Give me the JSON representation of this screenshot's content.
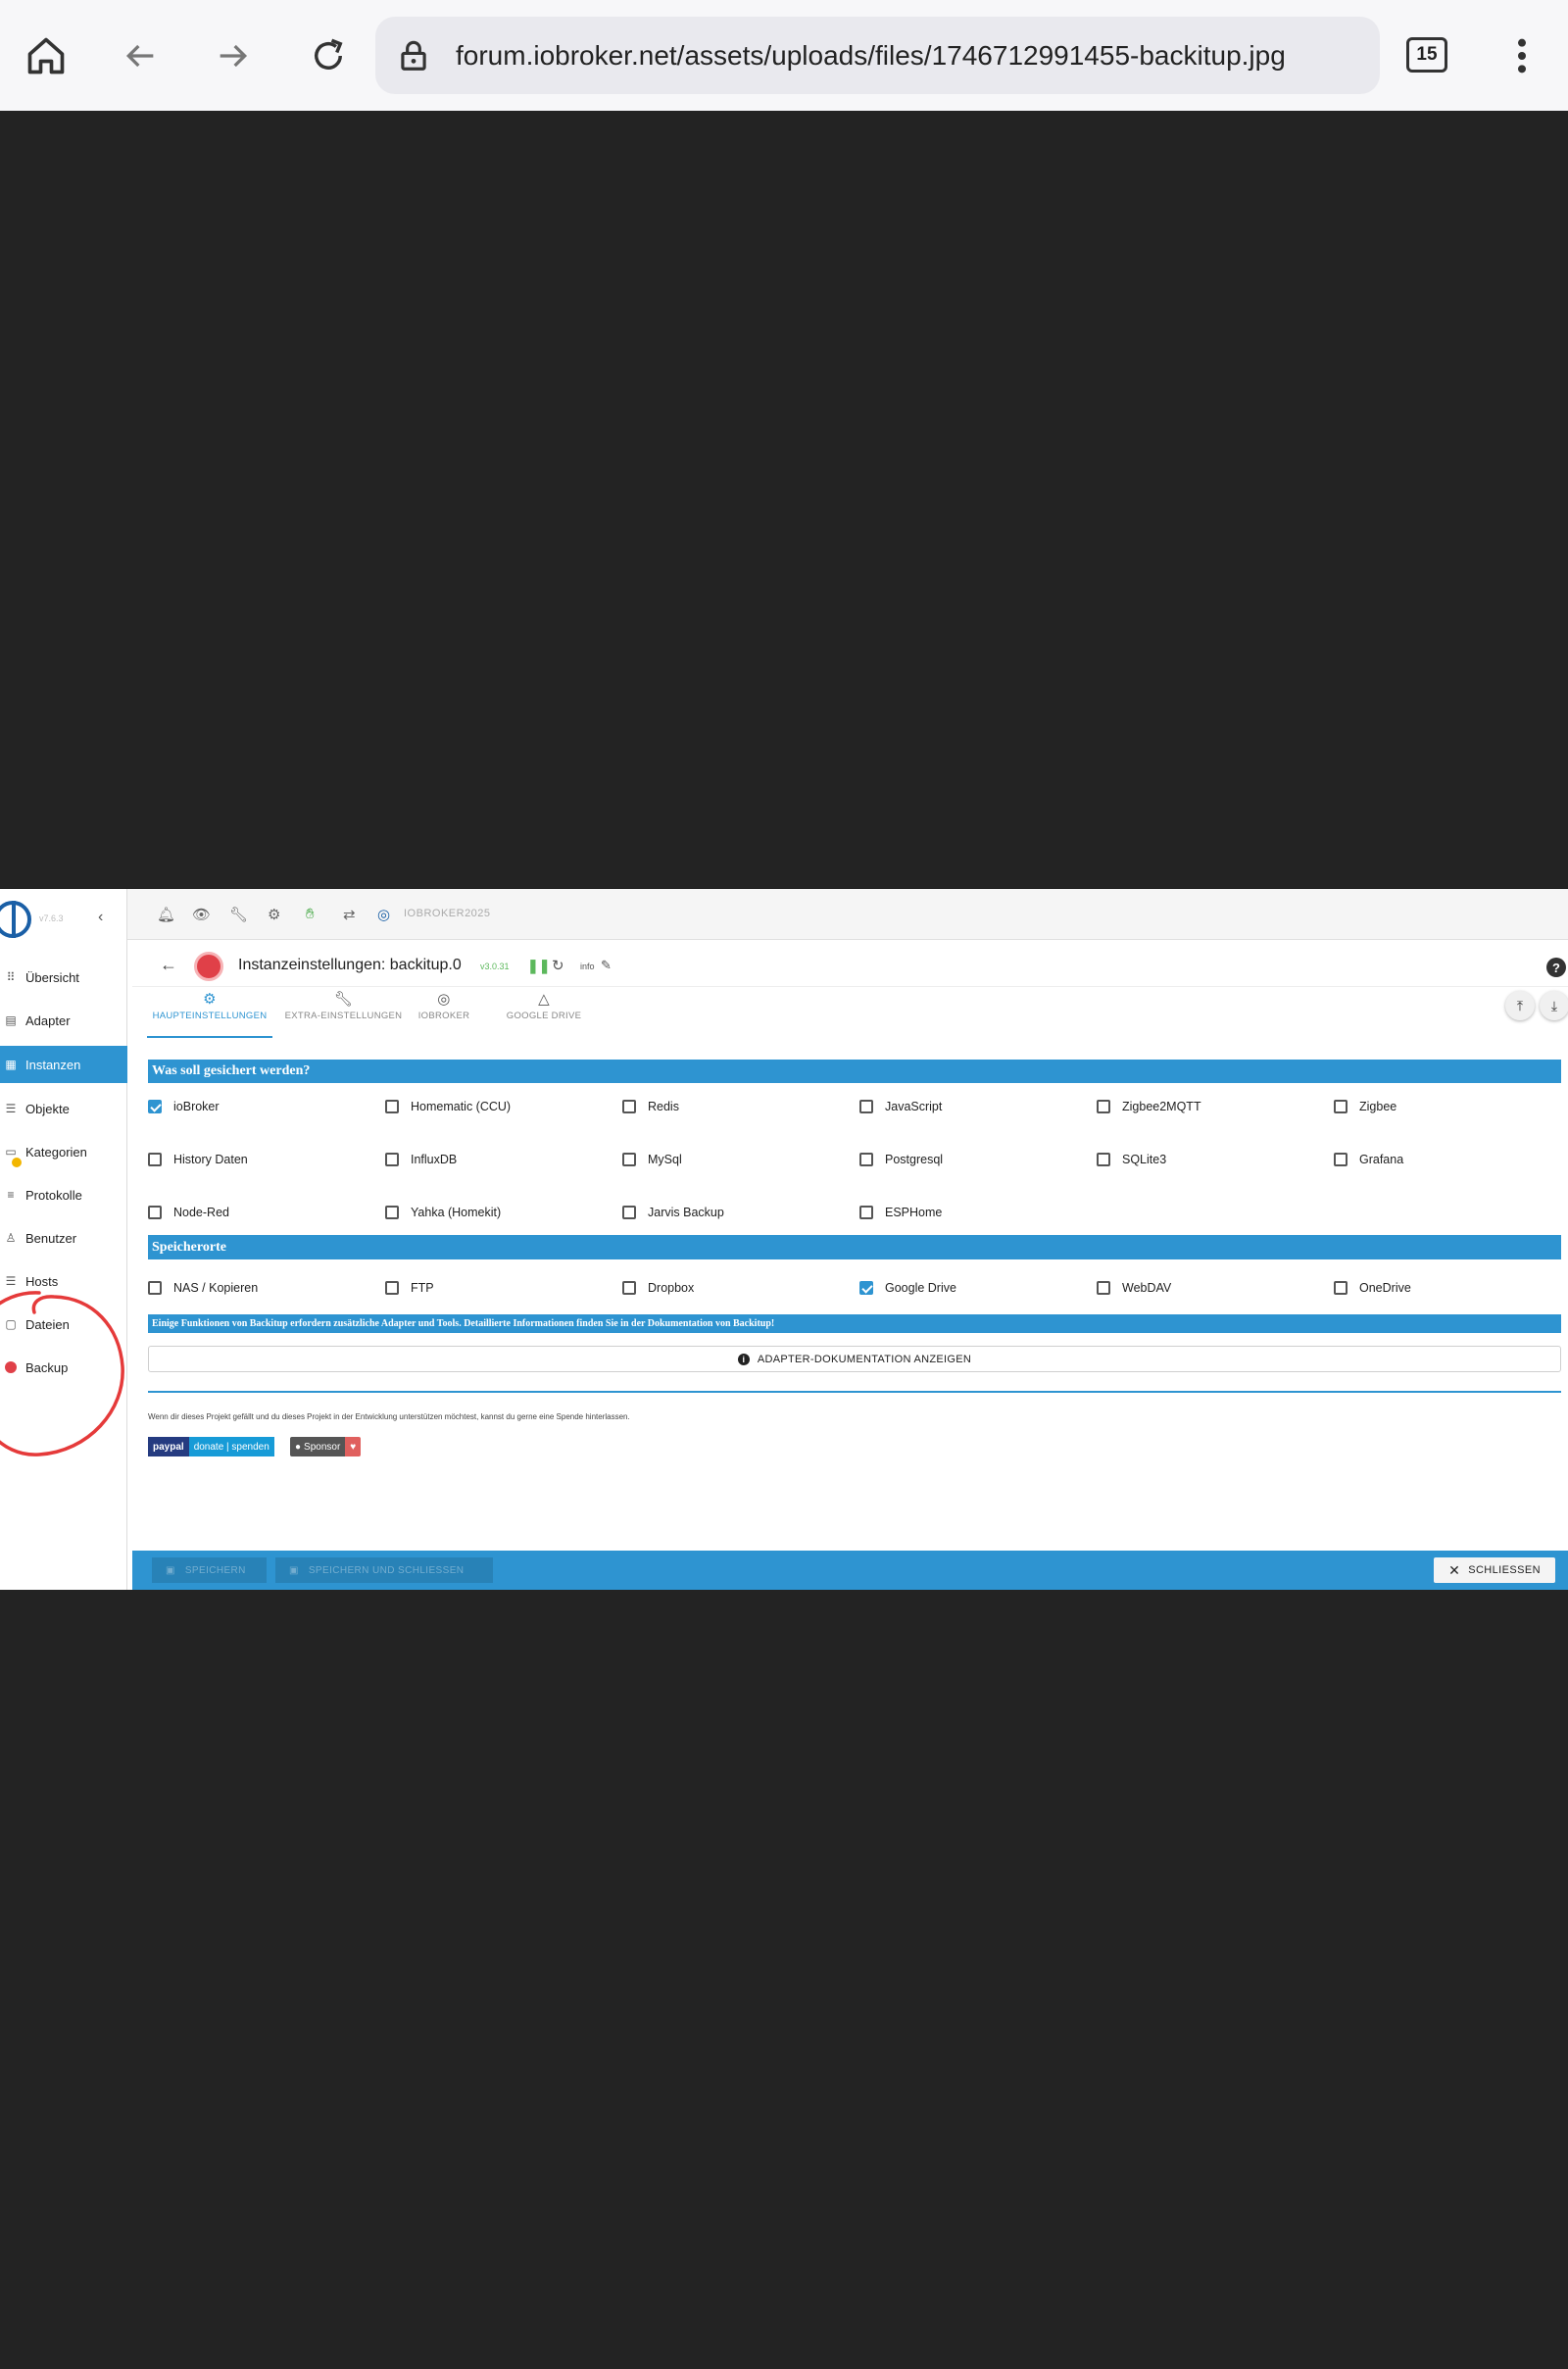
{
  "browser": {
    "url": "forum.iobroker.net/assets/uploads/files/1746712991455-backitup.jpg",
    "tab_count": "15"
  },
  "sidebar": {
    "version": "v7.6.3",
    "items": [
      {
        "label": "Übersicht",
        "icon": "grid-icon"
      },
      {
        "label": "Adapter",
        "icon": "store-icon"
      },
      {
        "label": "Instanzen",
        "icon": "instances-icon"
      },
      {
        "label": "Objekte",
        "icon": "list-icon"
      },
      {
        "label": "Kategorien",
        "icon": "categories-icon"
      },
      {
        "label": "Protokolle",
        "icon": "log-icon"
      },
      {
        "label": "Benutzer",
        "icon": "user-icon"
      },
      {
        "label": "Hosts",
        "icon": "hosts-icon"
      },
      {
        "label": "Dateien",
        "icon": "files-icon"
      },
      {
        "label": "Backup",
        "icon": "backup-icon"
      }
    ],
    "active_index": 2
  },
  "topbar": {
    "host": "IOBROKER2025"
  },
  "titlebar": {
    "title": "Instanzeinstellungen: backitup.0",
    "version": "v3.0.31",
    "info": "info"
  },
  "tabs": [
    {
      "label": "HAUPTEINSTELLUNGEN",
      "icon": "gear-icon"
    },
    {
      "label": "EXTRA-EINSTELLUNGEN",
      "icon": "wrench-icon"
    },
    {
      "label": "IOBROKER",
      "icon": "iobroker-icon"
    },
    {
      "label": "GOOGLE DRIVE",
      "icon": "google-drive-icon"
    }
  ],
  "section_what": {
    "title": "Was soll gesichert werden?",
    "rows": [
      [
        {
          "label": "ioBroker",
          "checked": true
        },
        {
          "label": "Homematic (CCU)",
          "checked": false
        },
        {
          "label": "Redis",
          "checked": false
        },
        {
          "label": "JavaScript",
          "checked": false
        },
        {
          "label": "Zigbee2MQTT",
          "checked": false
        },
        {
          "label": "Zigbee",
          "checked": false
        }
      ],
      [
        {
          "label": "History Daten",
          "checked": false
        },
        {
          "label": "InfluxDB",
          "checked": false
        },
        {
          "label": "MySql",
          "checked": false
        },
        {
          "label": "Postgresql",
          "checked": false
        },
        {
          "label": "SQLite3",
          "checked": false
        },
        {
          "label": "Grafana",
          "checked": false
        }
      ],
      [
        {
          "label": "Node-Red",
          "checked": false
        },
        {
          "label": "Yahka (Homekit)",
          "checked": false
        },
        {
          "label": "Jarvis Backup",
          "checked": false
        },
        {
          "label": "ESPHome",
          "checked": false
        }
      ]
    ]
  },
  "section_storage": {
    "title": "Speicherorte",
    "items": [
      {
        "label": "NAS / Kopieren",
        "checked": false
      },
      {
        "label": "FTP",
        "checked": false
      },
      {
        "label": "Dropbox",
        "checked": false
      },
      {
        "label": "Google Drive",
        "checked": true
      },
      {
        "label": "WebDAV",
        "checked": false
      },
      {
        "label": "OneDrive",
        "checked": false
      }
    ]
  },
  "info_bar": "Einige Funktionen von Backitup erfordern zusätzliche Adapter und Tools. Detaillierte Informationen finden Sie in der Dokumentation von Backitup!",
  "doc_button": "ADAPTER-DOKUMENTATION ANZEIGEN",
  "donate_note": "Wenn dir dieses Projekt gefällt und du dieses Projekt in der Entwicklung unterstützen möchtest, kannst du gerne eine Spende hinterlassen.",
  "paypal": {
    "brand": "paypal",
    "label": "donate | spenden"
  },
  "sponsor": {
    "label": "Sponsor",
    "heart": "♥"
  },
  "bottombar": {
    "save": "SPEICHERN",
    "save_close": "SPEICHERN UND SCHLIESSEN",
    "close": "SCHLIESSEN"
  },
  "colors": {
    "accent": "#2e94d1",
    "annotation": "#e53a3a",
    "backdrop": "#232323"
  }
}
